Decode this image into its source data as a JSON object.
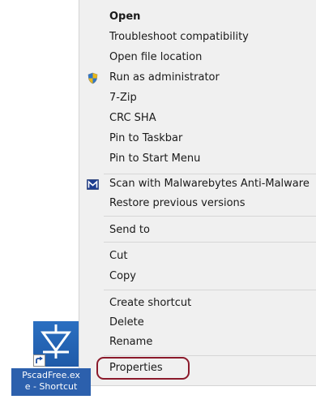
{
  "context_menu": {
    "items": [
      {
        "label": "Open",
        "bold": true
      },
      {
        "label": "Troubleshoot compatibility"
      },
      {
        "label": "Open file location"
      },
      {
        "label": "Run as administrator",
        "icon": "shield-icon"
      },
      {
        "label": "7-Zip"
      },
      {
        "label": "CRC SHA"
      },
      {
        "label": "Pin to Taskbar"
      },
      {
        "label": "Pin to Start Menu"
      },
      {
        "label": "Scan with Malwarebytes Anti-Malware",
        "icon": "malwarebytes-icon"
      },
      {
        "label": "Restore previous versions"
      },
      {
        "label": "Send to"
      },
      {
        "label": "Cut"
      },
      {
        "label": "Copy"
      },
      {
        "label": "Create shortcut"
      },
      {
        "label": "Delete"
      },
      {
        "label": "Rename"
      },
      {
        "label": "Properties",
        "highlighted": true
      }
    ]
  },
  "desktop_icon": {
    "caption_line1": "PscadFree.ex",
    "caption_line2": "e - Shortcut"
  },
  "colors": {
    "menu_background": "#f0f0f0",
    "highlight_border": "#8b1a2b",
    "icon_tile": "#1f5aa8",
    "caption_background": "#2c60ad"
  }
}
